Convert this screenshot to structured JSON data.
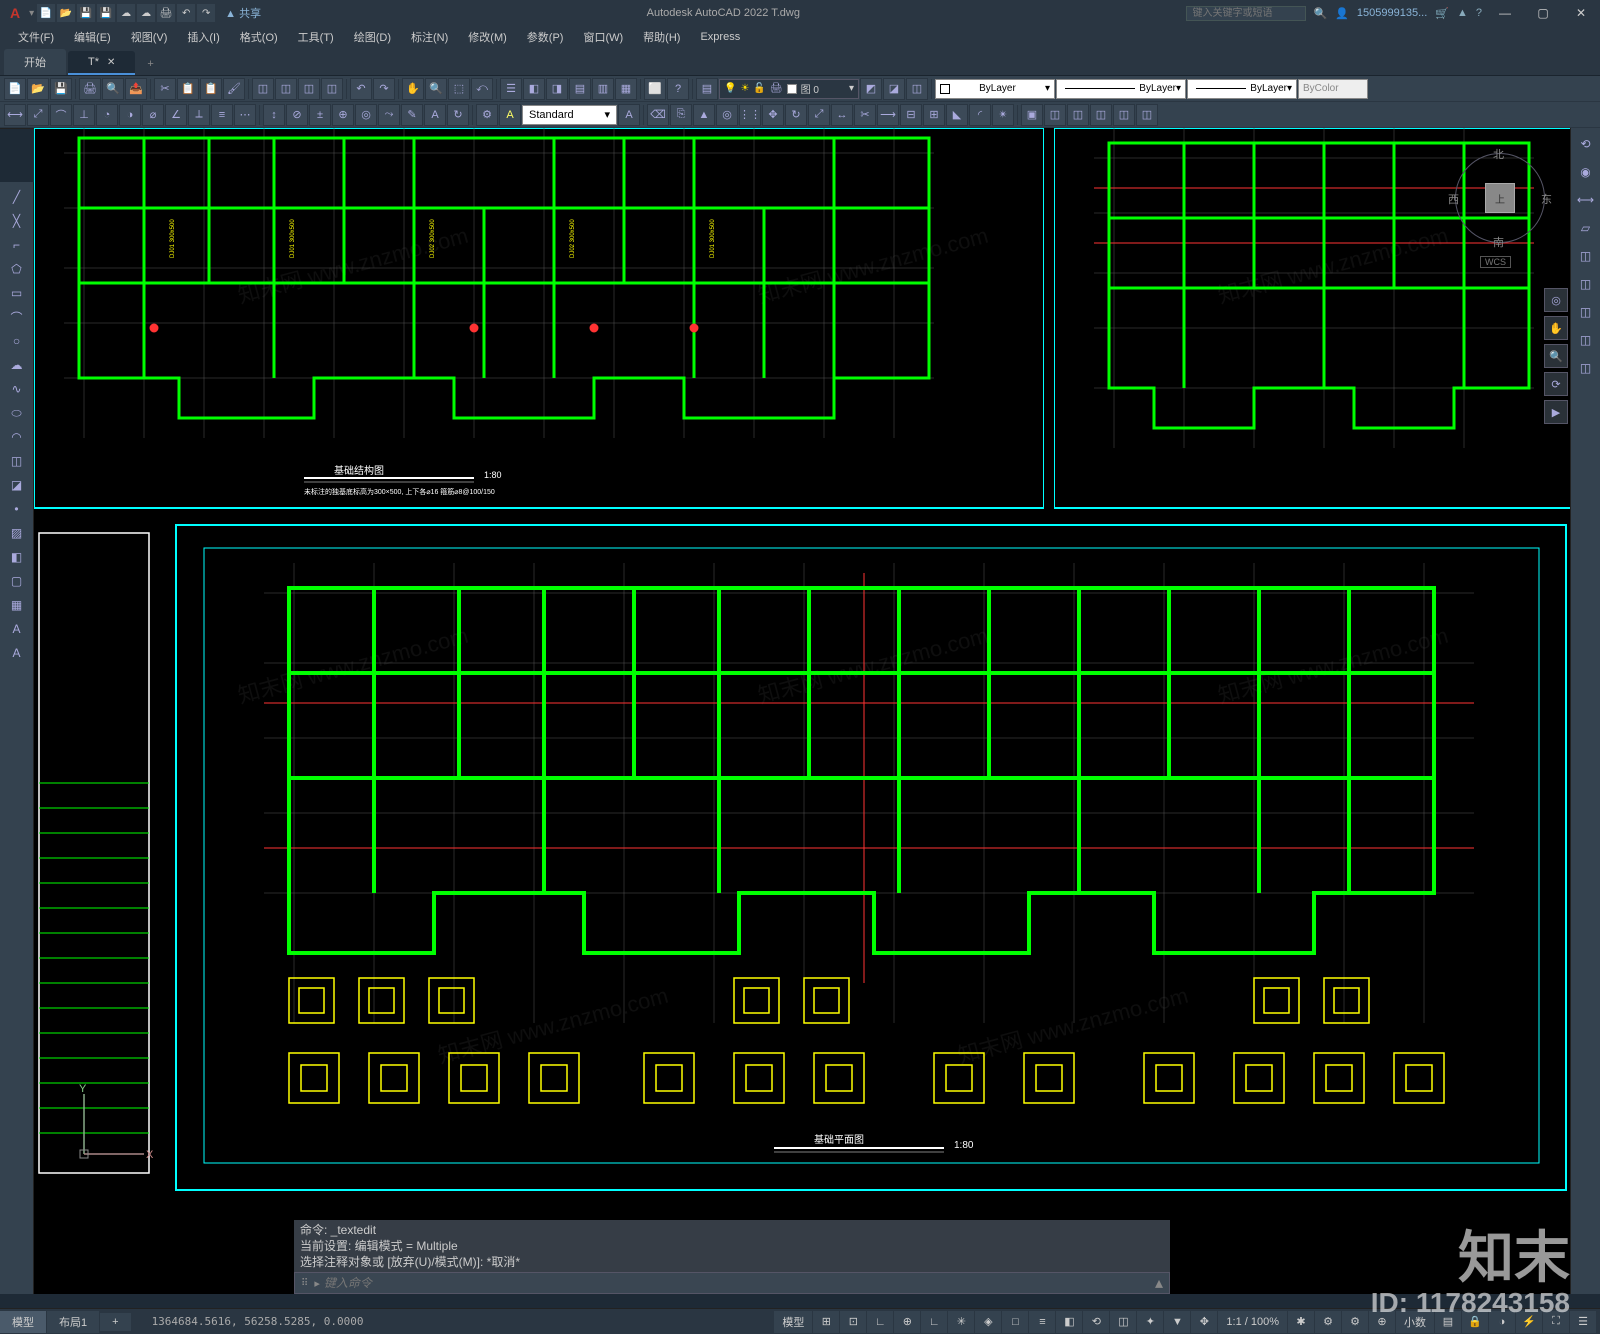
{
  "title_bar": {
    "logo": "A",
    "share": "▲ 共享",
    "app_title": "Autodesk AutoCAD 2022   T.dwg",
    "search_placeholder": "键入关键字或短语",
    "user": "1505999135...",
    "help": "?"
  },
  "menu": {
    "items": [
      "文件(F)",
      "编辑(E)",
      "视图(V)",
      "插入(I)",
      "格式(O)",
      "工具(T)",
      "绘图(D)",
      "标注(N)",
      "修改(M)",
      "参数(P)",
      "窗口(W)",
      "帮助(H)",
      "Express"
    ]
  },
  "tabs": {
    "start": "开始",
    "doc": "T*",
    "add": "+"
  },
  "ribbon": {
    "layer_current": "图 0",
    "text_style": "Standard",
    "prop_bylayer": "ByLayer",
    "prop_bycolor": "ByColor"
  },
  "view": {
    "cube_n": "北",
    "cube_s": "南",
    "cube_e": "东",
    "cube_w": "西",
    "cube_top": "上",
    "wcs": "WCS"
  },
  "drawing": {
    "title_upper": "基础结构图",
    "scale_upper": "1:80",
    "note_upper": "未标注的独基底标高为300×500, 上下各⌀16 箍筋⌀8@100/150",
    "title_lower": "基础平面图",
    "scale_lower": "1:80"
  },
  "cmd": {
    "line1": "命令: _textedit",
    "line2": "当前设置: 编辑模式 = Multiple",
    "line3": "选择注释对象或 [放弃(U)/模式(M)]: *取消*",
    "prompt": "▸",
    "placeholder": "键入命令"
  },
  "status": {
    "model_tab": "模型",
    "layout_tab": "布局1",
    "add_tab": "+",
    "coords": "1364684.5616, 56258.5285, 0.0000",
    "model_label": "模型",
    "scale": "1:1 / 100%",
    "decimal": "小数"
  },
  "watermark": {
    "text": "知末网 www.znzmo.com",
    "big": "知末",
    "id": "ID: 1178243158"
  }
}
